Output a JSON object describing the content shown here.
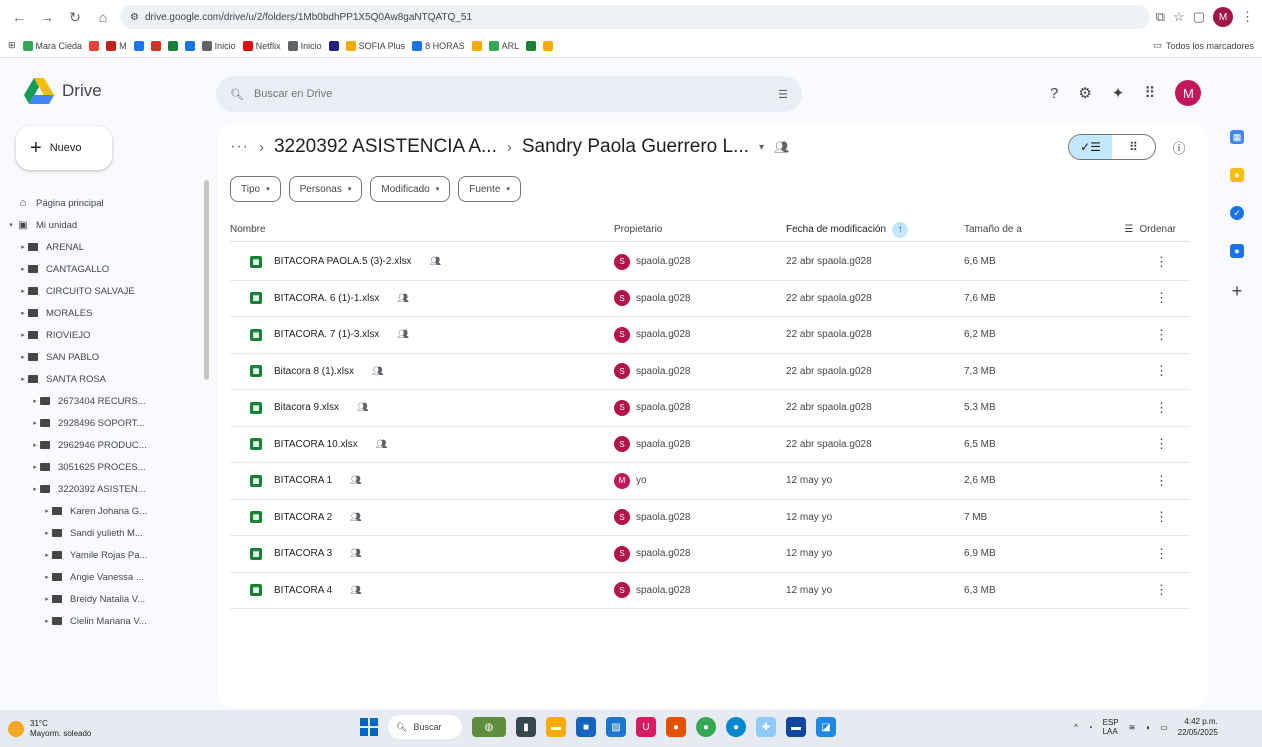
{
  "browser": {
    "url": "drive.google.com/drive/u/2/folders/1Mb0bdhPP1X5Q0Aw8gaNTQATQ_51",
    "bookmarks": [
      {
        "label": "Mara Cieda",
        "color": "#34a853"
      },
      {
        "label": "",
        "color": "#ea4335"
      },
      {
        "label": "M",
        "color": "#c5221f"
      },
      {
        "label": "",
        "color": "#1a73e8"
      },
      {
        "label": "",
        "color": "#d93025"
      },
      {
        "label": "",
        "color": "#188038"
      },
      {
        "label": "",
        "color": "#1a73e8"
      },
      {
        "label": "Inicio",
        "color": "#5f6368"
      },
      {
        "label": "Netflix",
        "color": "#e50914"
      },
      {
        "label": "Inicio",
        "color": "#5f6368"
      },
      {
        "label": "",
        "color": "#1a237e"
      },
      {
        "label": "SOFIA Plus",
        "color": "#f9ab00"
      },
      {
        "label": "8 HORAS",
        "color": "#1a73e8"
      },
      {
        "label": "",
        "color": "#f9ab00"
      },
      {
        "label": "ARL",
        "color": "#34a853"
      },
      {
        "label": "",
        "color": "#188038"
      },
      {
        "label": "",
        "color": "#f9ab00"
      }
    ],
    "all_bookmarks_label": "Todos los marcadores",
    "profile_initial": "M"
  },
  "header": {
    "app_name": "Drive",
    "search_placeholder": "Buscar en Drive",
    "avatar_initial": "M"
  },
  "sidebar": {
    "new_label": "Nuevo",
    "home_label": "Página principal",
    "my_drive_label": "Mi unidad",
    "folders": [
      {
        "label": "ARENAL",
        "level": 1,
        "shared": false
      },
      {
        "label": "CANTAGALLO",
        "level": 1,
        "shared": false
      },
      {
        "label": "CIRCUITO SALVAJE",
        "level": 1,
        "shared": true
      },
      {
        "label": "MORALES",
        "level": 1,
        "shared": false
      },
      {
        "label": "RIOVIEJO",
        "level": 1,
        "shared": false
      },
      {
        "label": "SAN PABLO",
        "level": 1,
        "shared": false
      },
      {
        "label": "SANTA ROSA",
        "level": 1,
        "shared": false
      },
      {
        "label": "2673404 RECURS...",
        "level": 2,
        "shared": false
      },
      {
        "label": "2928496 SOPORT...",
        "level": 2,
        "shared": false
      },
      {
        "label": "2962946 PRODUC...",
        "level": 2,
        "shared": false
      },
      {
        "label": "3051625 PROCES...",
        "level": 2,
        "shared": false
      },
      {
        "label": "3220392 ASISTEN...",
        "level": 2,
        "shared": false
      },
      {
        "label": "Karen Johana G...",
        "level": 3,
        "shared": true
      },
      {
        "label": "Sandi yulieth M...",
        "level": 3,
        "shared": true
      },
      {
        "label": "Yamile Rojas Pa...",
        "level": 3,
        "shared": true
      },
      {
        "label": "Angie Vanessa ...",
        "level": 3,
        "shared": true
      },
      {
        "label": "Breidy Natalia V...",
        "level": 3,
        "shared": true
      },
      {
        "label": "Cielin Mariana V...",
        "level": 3,
        "shared": true
      }
    ]
  },
  "main": {
    "breadcrumb": {
      "more": "···",
      "parent": "3220392 ASISTENCIA A...",
      "current": "Sandry Paola Guerrero L..."
    },
    "filters": [
      "Tipo",
      "Personas",
      "Modificado",
      "Fuente"
    ],
    "columns": {
      "name": "Nombre",
      "owner": "Propietario",
      "modified": "Fecha de modificación",
      "size": "Tamaño de a",
      "sort": "Ordenar"
    },
    "files": [
      {
        "name": "BITACORA PAOLA.5 (3)-2.xlsx",
        "owner": "spaola.g028",
        "owner_initial": "S",
        "modified": "22 abr spaola.g028",
        "size": "6,6 MB"
      },
      {
        "name": "BITACORA. 6 (1)-1.xlsx",
        "owner": "spaola.g028",
        "owner_initial": "S",
        "modified": "22 abr spaola.g028",
        "size": "7,6 MB"
      },
      {
        "name": "BITACORA. 7 (1)-3.xlsx",
        "owner": "spaola.g028",
        "owner_initial": "S",
        "modified": "22 abr spaola.g028",
        "size": "6,2 MB"
      },
      {
        "name": "Bitacora 8 (1).xlsx",
        "owner": "spaola.g028",
        "owner_initial": "S",
        "modified": "22 abr spaola.g028",
        "size": "7,3 MB"
      },
      {
        "name": "Bitacora 9.xlsx",
        "owner": "spaola.g028",
        "owner_initial": "S",
        "modified": "22 abr spaola.g028",
        "size": "5,3 MB"
      },
      {
        "name": "BITACORA 10.xlsx",
        "owner": "spaola.g028",
        "owner_initial": "S",
        "modified": "22 abr spaola.g028",
        "size": "6,5 MB"
      },
      {
        "name": "BITACORA 1",
        "owner": "yo",
        "owner_initial": "M",
        "modified": "12 may yo",
        "size": "2,6 MB"
      },
      {
        "name": "BITACORA 2",
        "owner": "spaola.g028",
        "owner_initial": "S",
        "modified": "12 may yo",
        "size": "7 MB"
      },
      {
        "name": "BITACORA 3",
        "owner": "spaola.g028",
        "owner_initial": "S",
        "modified": "12 may yo",
        "size": "6,9 MB"
      },
      {
        "name": "BITACORA 4",
        "owner": "spaola.g028",
        "owner_initial": "S",
        "modified": "12 may yo",
        "size": "6,3 MB"
      }
    ]
  },
  "taskbar": {
    "temp": "31°C",
    "weather": "Mayorm. soleado",
    "search_label": "Buscar",
    "lang": "ESP",
    "region": "LAA",
    "time": "4:42 p.m.",
    "date": "22/05/2025"
  },
  "colors": {
    "accent": "#c2e7ff",
    "excel": "#188038",
    "avatar": "#c2185b"
  }
}
